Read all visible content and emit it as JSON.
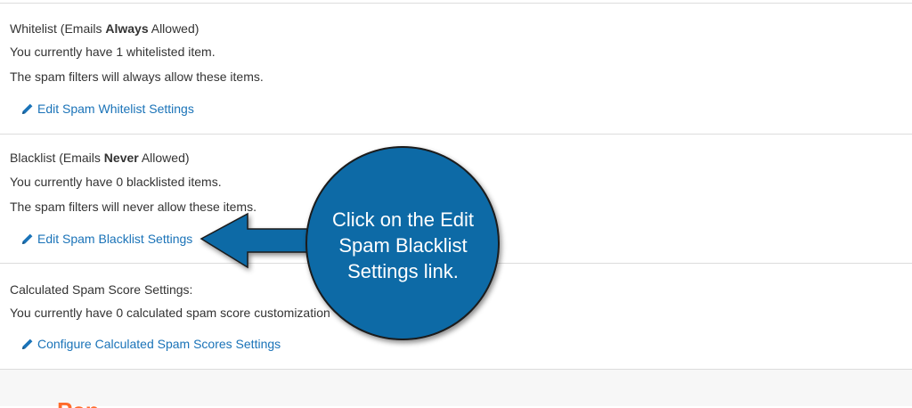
{
  "whitelist": {
    "title_prefix": "Whitelist (Emails ",
    "title_bold": "Always",
    "title_suffix": " Allowed)",
    "count_text": "You currently have 1 whitelisted item.",
    "desc_text": "The spam filters will always allow these items.",
    "link_label": "Edit Spam Whitelist Settings"
  },
  "blacklist": {
    "title_prefix": "Blacklist (Emails ",
    "title_bold": "Never",
    "title_suffix": " Allowed)",
    "count_text": "You currently have 0 blacklisted items.",
    "desc_text": "The spam filters will never allow these items.",
    "link_label": "Edit Spam Blacklist Settings"
  },
  "score": {
    "title": "Calculated Spam Score Settings:",
    "count_text": "You currently have 0 calculated spam score customization",
    "link_label": "Configure Calculated Spam Scores Settings"
  },
  "callout": {
    "line1": "Click on the Edit",
    "line2": "Spam Blacklist",
    "line3": "Settings link."
  },
  "footer": {
    "logo_fragment": "Pan"
  },
  "colors": {
    "link": "#1a73b8",
    "callout_fill": "#0c6aa6",
    "logo": "#ff6c2c"
  },
  "icons": {
    "link_icon": "pencil-icon"
  }
}
